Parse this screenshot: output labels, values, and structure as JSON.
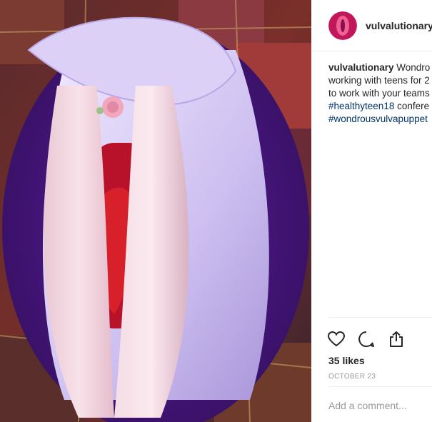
{
  "post": {
    "username": "vulvalutionary",
    "caption": {
      "author": "vulvalutionary",
      "lines": [
        " Wondro",
        "working with teens for 2",
        "to work with your teams"
      ],
      "tag_line": {
        "tag": "#healthyteen18",
        "rest": " confere"
      },
      "last_tag": "#wondrousvulvapuppet"
    },
    "likes": "35 likes",
    "date": "OCTOBER 23",
    "comment_placeholder": "Add a comment..."
  },
  "icons": {
    "like": "heart-icon",
    "comment": "comment-bubble-icon",
    "share": "share-icon"
  },
  "colors": {
    "link": "#003569",
    "muted": "#999999",
    "text": "#262626"
  }
}
